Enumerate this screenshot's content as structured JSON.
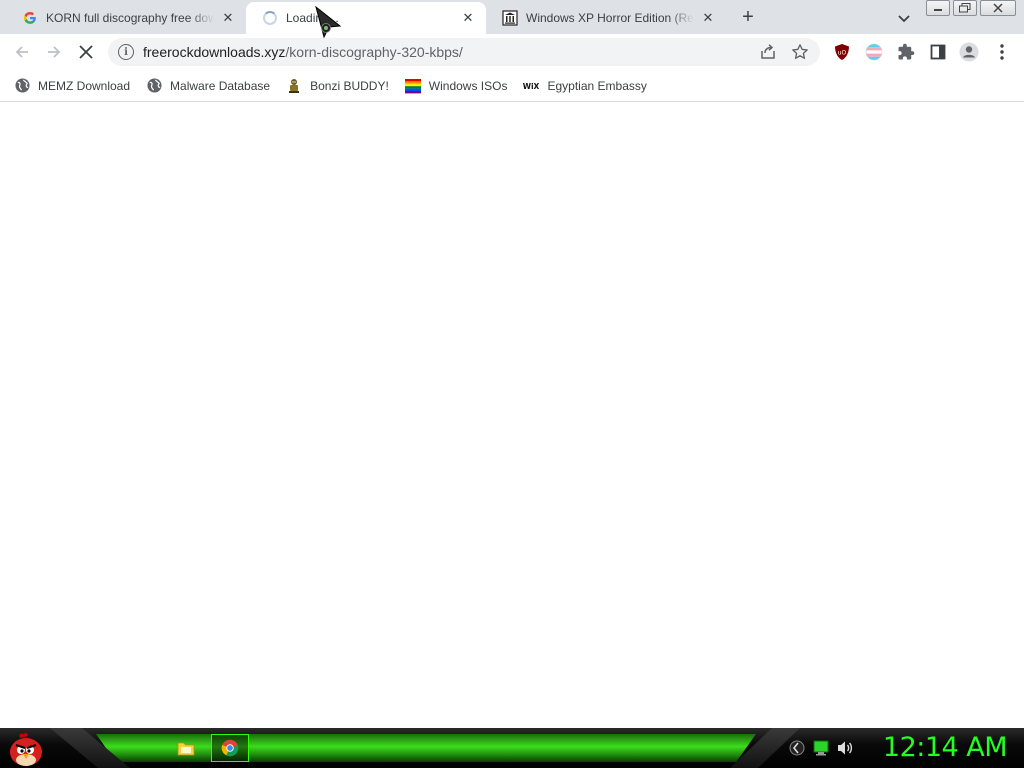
{
  "tabs": [
    {
      "title": "KORN full discography free download",
      "favicon": "google-icon",
      "active": false
    },
    {
      "title": "Loading...",
      "favicon": "loading-spinner",
      "active": true
    },
    {
      "title": "Windows XP Horror Edition (Reactions)",
      "favicon": "museum-icon",
      "active": false
    }
  ],
  "toolbar": {
    "url_host": "freerockdownloads.xyz",
    "url_path": "/korn-discography-320-kbps/"
  },
  "bookmarks": [
    {
      "label": "MEMZ Download",
      "icon": "globe-icon"
    },
    {
      "label": "Malware Database",
      "icon": "globe-icon"
    },
    {
      "label": "Bonzi BUDDY!",
      "icon": "bonzi-icon"
    },
    {
      "label": "Windows ISOs",
      "icon": "rainbow-flag-icon"
    },
    {
      "label": "Egyptian Embassy",
      "icon": "wix-icon"
    }
  ],
  "taskbar": {
    "clock": "12:14 AM",
    "accent_color": "#22ff22"
  },
  "colors": {
    "tabstrip": "#dee1e6",
    "omnibox": "#f1f3f4"
  }
}
